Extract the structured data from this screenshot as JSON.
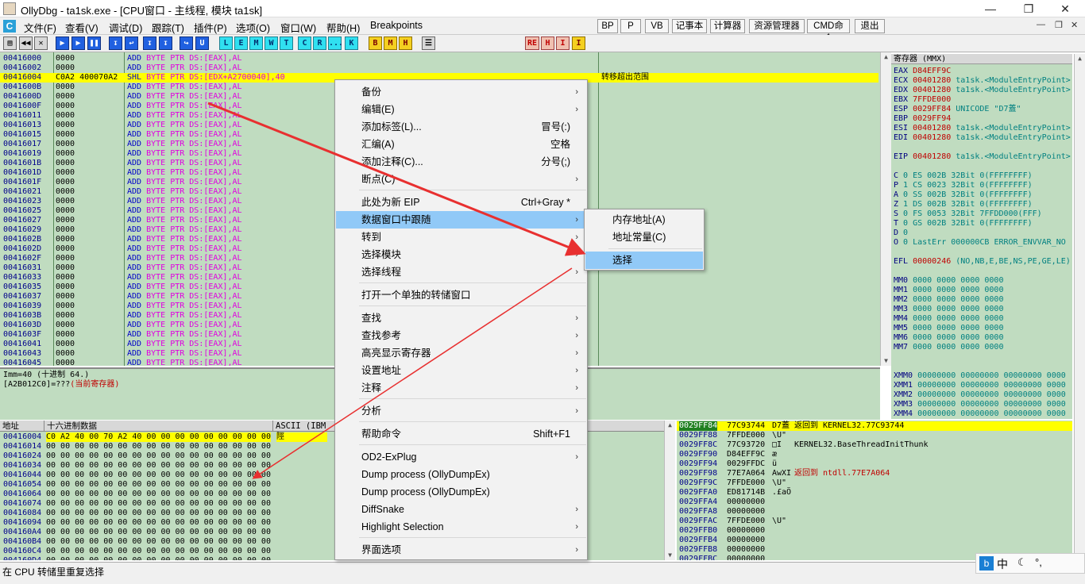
{
  "window": {
    "title": "OllyDbg - ta1sk.exe - [CPU窗口 - 主线程, 模块 ta1sk]"
  },
  "menubar": {
    "items": [
      "文件(F)",
      "查看(V)",
      "调试(D)",
      "跟踪(T)",
      "插件(P)",
      "选项(O)",
      "窗口(W)",
      "帮助(H)",
      "Breakpoints"
    ],
    "right_buttons": [
      "BP",
      "P",
      "VB",
      "记事本",
      "计算器",
      "资源管理器",
      "CMD命令",
      "退出"
    ]
  },
  "toolbar": {
    "letters": [
      "L",
      "E",
      "M",
      "W",
      "T",
      "C",
      "R",
      "...",
      "K",
      "B",
      "M",
      "H"
    ],
    "extra": [
      "RE",
      "H",
      "I",
      "I"
    ]
  },
  "cpu": {
    "rows": [
      {
        "addr": "00416000",
        "hex": "0000",
        "mn": "ADD",
        "arg": "BYTE PTR DS:[EAX],AL",
        "cm": ""
      },
      {
        "addr": "00416002",
        "hex": "0000",
        "mn": "ADD",
        "arg": "BYTE PTR DS:[EAX],AL",
        "cm": ""
      },
      {
        "addr": "00416004",
        "hex": "C0A2 400070A2",
        "mn": "SHL",
        "arg": "BYTE PTR DS:[EDX+A2700040],40",
        "cm": "转移超出范围",
        "sel": true
      },
      {
        "addr": "0041600B",
        "hex": "0000",
        "mn": "ADD",
        "arg": "BYTE PTR DS:[EAX],AL",
        "cm": ""
      },
      {
        "addr": "0041600D",
        "hex": "0000",
        "mn": "ADD",
        "arg": "BYTE PTR DS:[EAX],AL",
        "cm": ""
      },
      {
        "addr": "0041600F",
        "hex": "0000",
        "mn": "ADD",
        "arg": "BYTE PTR DS:[EAX],AL",
        "cm": ""
      },
      {
        "addr": "00416011",
        "hex": "0000",
        "mn": "ADD",
        "arg": "BYTE PTR DS:[EAX],AL",
        "cm": ""
      },
      {
        "addr": "00416013",
        "hex": "0000",
        "mn": "ADD",
        "arg": "BYTE PTR DS:[EAX],AL",
        "cm": ""
      },
      {
        "addr": "00416015",
        "hex": "0000",
        "mn": "ADD",
        "arg": "BYTE PTR DS:[EAX],AL",
        "cm": ""
      },
      {
        "addr": "00416017",
        "hex": "0000",
        "mn": "ADD",
        "arg": "BYTE PTR DS:[EAX],AL",
        "cm": ""
      },
      {
        "addr": "00416019",
        "hex": "0000",
        "mn": "ADD",
        "arg": "BYTE PTR DS:[EAX],AL",
        "cm": ""
      },
      {
        "addr": "0041601B",
        "hex": "0000",
        "mn": "ADD",
        "arg": "BYTE PTR DS:[EAX],AL",
        "cm": ""
      },
      {
        "addr": "0041601D",
        "hex": "0000",
        "mn": "ADD",
        "arg": "BYTE PTR DS:[EAX],AL",
        "cm": ""
      },
      {
        "addr": "0041601F",
        "hex": "0000",
        "mn": "ADD",
        "arg": "BYTE PTR DS:[EAX],AL",
        "cm": ""
      },
      {
        "addr": "00416021",
        "hex": "0000",
        "mn": "ADD",
        "arg": "BYTE PTR DS:[EAX],AL",
        "cm": ""
      },
      {
        "addr": "00416023",
        "hex": "0000",
        "mn": "ADD",
        "arg": "BYTE PTR DS:[EAX],AL",
        "cm": ""
      },
      {
        "addr": "00416025",
        "hex": "0000",
        "mn": "ADD",
        "arg": "BYTE PTR DS:[EAX],AL",
        "cm": ""
      },
      {
        "addr": "00416027",
        "hex": "0000",
        "mn": "ADD",
        "arg": "BYTE PTR DS:[EAX],AL",
        "cm": ""
      },
      {
        "addr": "00416029",
        "hex": "0000",
        "mn": "ADD",
        "arg": "BYTE PTR DS:[EAX],AL",
        "cm": ""
      },
      {
        "addr": "0041602B",
        "hex": "0000",
        "mn": "ADD",
        "arg": "BYTE PTR DS:[EAX],AL",
        "cm": ""
      },
      {
        "addr": "0041602D",
        "hex": "0000",
        "mn": "ADD",
        "arg": "BYTE PTR DS:[EAX],AL",
        "cm": ""
      },
      {
        "addr": "0041602F",
        "hex": "0000",
        "mn": "ADD",
        "arg": "BYTE PTR DS:[EAX],AL",
        "cm": ""
      },
      {
        "addr": "00416031",
        "hex": "0000",
        "mn": "ADD",
        "arg": "BYTE PTR DS:[EAX],AL",
        "cm": ""
      },
      {
        "addr": "00416033",
        "hex": "0000",
        "mn": "ADD",
        "arg": "BYTE PTR DS:[EAX],AL",
        "cm": ""
      },
      {
        "addr": "00416035",
        "hex": "0000",
        "mn": "ADD",
        "arg": "BYTE PTR DS:[EAX],AL",
        "cm": ""
      },
      {
        "addr": "00416037",
        "hex": "0000",
        "mn": "ADD",
        "arg": "BYTE PTR DS:[EAX],AL",
        "cm": ""
      },
      {
        "addr": "00416039",
        "hex": "0000",
        "mn": "ADD",
        "arg": "BYTE PTR DS:[EAX],AL",
        "cm": ""
      },
      {
        "addr": "0041603B",
        "hex": "0000",
        "mn": "ADD",
        "arg": "BYTE PTR DS:[EAX],AL",
        "cm": ""
      },
      {
        "addr": "0041603D",
        "hex": "0000",
        "mn": "ADD",
        "arg": "BYTE PTR DS:[EAX],AL",
        "cm": ""
      },
      {
        "addr": "0041603F",
        "hex": "0000",
        "mn": "ADD",
        "arg": "BYTE PTR DS:[EAX],AL",
        "cm": ""
      },
      {
        "addr": "00416041",
        "hex": "0000",
        "mn": "ADD",
        "arg": "BYTE PTR DS:[EAX],AL",
        "cm": ""
      },
      {
        "addr": "00416043",
        "hex": "0000",
        "mn": "ADD",
        "arg": "BYTE PTR DS:[EAX],AL",
        "cm": ""
      },
      {
        "addr": "00416045",
        "hex": "0000",
        "mn": "ADD",
        "arg": "BYTE PTR DS:[EAX],AL",
        "cm": ""
      }
    ]
  },
  "registers": {
    "header": "寄存器 (MMX)",
    "lines": [
      "EAX D84EFF9C",
      "ECX 00401280 ta1sk.<ModuleEntryPoint>",
      "EDX 00401280 ta1sk.<ModuleEntryPoint>",
      "EBX 7FFDE000",
      "ESP 0029FF84 UNICODE \"D7蓋\"",
      "EBP 0029FF94",
      "ESI 00401280 ta1sk.<ModuleEntryPoint>",
      "EDI 00401280 ta1sk.<ModuleEntryPoint>",
      "",
      "EIP 00401280 ta1sk.<ModuleEntryPoint>",
      "",
      "C 0  ES 002B 32Bit 0(FFFFFFFF)",
      "P 1  CS 0023 32Bit 0(FFFFFFFF)",
      "A 0  SS 002B 32Bit 0(FFFFFFFF)",
      "Z 1  DS 002B 32Bit 0(FFFFFFFF)",
      "S 0  FS 0053 32Bit 7FFDD000(FFF)",
      "T 0  GS 002B 32Bit 0(FFFFFFFF)",
      "D 0",
      "O 0  LastErr 000000CB ERROR_ENVVAR_NO",
      "",
      "EFL 00000246 (NO,NB,E,BE,NS,PE,GE,LE)",
      "",
      "MM0 0000 0000 0000 0000",
      "MM1 0000 0000 0000 0000",
      "MM2 0000 0000 0000 0000",
      "MM3 0000 0000 0000 0000",
      "MM4 0000 0000 0000 0000",
      "MM5 0000 0000 0000 0000",
      "MM6 0000 0000 0000 0000",
      "MM7 0000 0000 0000 0000",
      "",
      "",
      "XMM0 00000000 00000000 00000000 0000",
      "XMM1 00000000 00000000 00000000 0000",
      "XMM2 00000000 00000000 00000000 0000",
      "XMM3 00000000 00000000 00000000 0000",
      "XMM4 00000000 00000000 00000000 0000",
      "XMM5 00000000 00000000 00000000 0000",
      "XMM6 76D8DDB5 C1C66C42 AEF8E142 9F1D1",
      "XMM7 00010203 04050607 08090A0B 0C0D0"
    ]
  },
  "info": {
    "line1": "Imm=40 (十进制 64.)",
    "line2": "[A2B012C0]=???",
    "line2_red": "(当前寄存器)"
  },
  "dump": {
    "headers": [
      "地址",
      "十六进制数据",
      "ASCII (IBM"
    ],
    "rows": [
      {
        "addr": "00416004",
        "hex": "C0 A2 40 00 70 A2 40 00 00 00 00 00 00 00 00 00",
        "ascii": "陘"
      },
      {
        "addr": "00416014",
        "hex": "00 00 00 00 00 00 00 00 00 00 00 00 00 00 00 00",
        "ascii": ""
      },
      {
        "addr": "00416024",
        "hex": "00 00 00 00 00 00 00 00 00 00 00 00 00 00 00 00",
        "ascii": ""
      },
      {
        "addr": "00416034",
        "hex": "00 00 00 00 00 00 00 00 00 00 00 00 00 00 00 00",
        "ascii": ""
      },
      {
        "addr": "00416044",
        "hex": "00 00 00 00 00 00 00 00 00 00 00 00 00 00 00 00",
        "ascii": ""
      },
      {
        "addr": "00416054",
        "hex": "00 00 00 00 00 00 00 00 00 00 00 00 00 00 00 00",
        "ascii": ""
      },
      {
        "addr": "00416064",
        "hex": "00 00 00 00 00 00 00 00 00 00 00 00 00 00 00 00",
        "ascii": ""
      },
      {
        "addr": "00416074",
        "hex": "00 00 00 00 00 00 00 00 00 00 00 00 00 00 00 00",
        "ascii": ""
      },
      {
        "addr": "00416084",
        "hex": "00 00 00 00 00 00 00 00 00 00 00 00 00 00 00 00",
        "ascii": ""
      },
      {
        "addr": "00416094",
        "hex": "00 00 00 00 00 00 00 00 00 00 00 00 00 00 00 00",
        "ascii": ""
      },
      {
        "addr": "004160A4",
        "hex": "00 00 00 00 00 00 00 00 00 00 00 00 00 00 00 00",
        "ascii": ""
      },
      {
        "addr": "004160B4",
        "hex": "00 00 00 00 00 00 00 00 00 00 00 00 00 00 00 00",
        "ascii": ""
      },
      {
        "addr": "004160C4",
        "hex": "00 00 00 00 00 00 00 00 00 00 00 00 00 00 00 00",
        "ascii": ""
      },
      {
        "addr": "004160D4",
        "hex": "00 00 00 00 00 00 00 00 00 00 00 00 00 00 00 00",
        "ascii": ""
      }
    ]
  },
  "stack": {
    "rows": [
      {
        "addr": "0029FF84",
        "val": "77C93744",
        "as": "D7蓋",
        "cm": "返回到 KERNEL32.77C93744",
        "sel": true
      },
      {
        "addr": "0029FF88",
        "val": "7FFDE000",
        "as": "\\U\"",
        "cm": ""
      },
      {
        "addr": "0029FF8C",
        "val": "77C93720",
        "as": "□I",
        "cm": "KERNEL32.BaseThreadInitThunk"
      },
      {
        "addr": "0029FF90",
        "val": "D84EFF9C",
        "as": "æ",
        "cm": ""
      },
      {
        "addr": "0029FF94",
        "val": "0029FFDC",
        "as": "ü",
        "cm": ""
      },
      {
        "addr": "0029FF98",
        "val": "77E7A064",
        "as": "AwXI",
        "cm": "返回到 ntdll.77E7A064",
        "red": true
      },
      {
        "addr": "0029FF9C",
        "val": "7FFDE000",
        "as": "\\U\"",
        "cm": ""
      },
      {
        "addr": "0029FFA0",
        "val": "ED81714B",
        "as": ".£aÖ",
        "cm": ""
      },
      {
        "addr": "0029FFA4",
        "val": "00000000",
        "as": "",
        "cm": ""
      },
      {
        "addr": "0029FFA8",
        "val": "00000000",
        "as": "",
        "cm": ""
      },
      {
        "addr": "0029FFAC",
        "val": "7FFDE000",
        "as": "\\U\"",
        "cm": ""
      },
      {
        "addr": "0029FFB0",
        "val": "00000000",
        "as": "",
        "cm": ""
      },
      {
        "addr": "0029FFB4",
        "val": "00000000",
        "as": "",
        "cm": ""
      },
      {
        "addr": "0029FFB8",
        "val": "00000000",
        "as": "",
        "cm": ""
      },
      {
        "addr": "0029FFBC",
        "val": "00000000",
        "as": "",
        "cm": ""
      }
    ]
  },
  "context_menu": {
    "items": [
      {
        "label": "备份",
        "sc": "",
        "sub": true
      },
      {
        "label": "编辑(E)",
        "sc": "",
        "sub": true
      },
      {
        "label": "添加标签(L)...",
        "sc": "冒号(:)",
        "sub": false
      },
      {
        "label": "汇编(A)",
        "sc": "空格",
        "sub": false
      },
      {
        "label": "添加注释(C)...",
        "sc": "分号(;)",
        "sub": false
      },
      {
        "label": "断点(C)",
        "sc": "",
        "sub": true
      },
      {
        "label": "此处为新 EIP",
        "sc": "Ctrl+Gray *",
        "sub": false
      },
      {
        "label": "数据窗口中跟随",
        "sc": "",
        "sub": true,
        "hi": true
      },
      {
        "label": "转到",
        "sc": "",
        "sub": true
      },
      {
        "label": "选择模块",
        "sc": "",
        "sub": true
      },
      {
        "label": "选择线程",
        "sc": "",
        "sub": true
      },
      {
        "label": "打开一个单独的转储窗口",
        "sc": "",
        "sub": false
      },
      {
        "label": "查找",
        "sc": "",
        "sub": true
      },
      {
        "label": "查找参考",
        "sc": "",
        "sub": true
      },
      {
        "label": "高亮显示寄存器",
        "sc": "",
        "sub": true
      },
      {
        "label": "设置地址",
        "sc": "",
        "sub": true
      },
      {
        "label": "注释",
        "sc": "",
        "sub": true
      },
      {
        "label": "分析",
        "sc": "",
        "sub": true
      },
      {
        "label": "帮助命令",
        "sc": "Shift+F1",
        "sub": false
      },
      {
        "label": "OD2-ExPlug",
        "sc": "",
        "sub": true
      },
      {
        "label": "Dump process (OllyDumpEx)",
        "sc": "",
        "sub": false
      },
      {
        "label": "Dump process (OllyDumpEx)",
        "sc": "",
        "sub": false
      },
      {
        "label": "DiffSnake",
        "sc": "",
        "sub": true
      },
      {
        "label": "Highlight Selection",
        "sc": "",
        "sub": true
      },
      {
        "label": "界面选项",
        "sc": "",
        "sub": true
      }
    ]
  },
  "submenu": {
    "items": [
      "内存地址(A)",
      "地址常量(C)",
      "选择"
    ]
  },
  "statusbar": {
    "text": "在 CPU 转储里重复选择"
  },
  "taskbar": {
    "ime": "中"
  },
  "colors": {
    "pane_bg": "#c0dcc0",
    "selection": "#ffff00",
    "menu_highlight": "#91c9f7",
    "arrow": "#e83030"
  }
}
